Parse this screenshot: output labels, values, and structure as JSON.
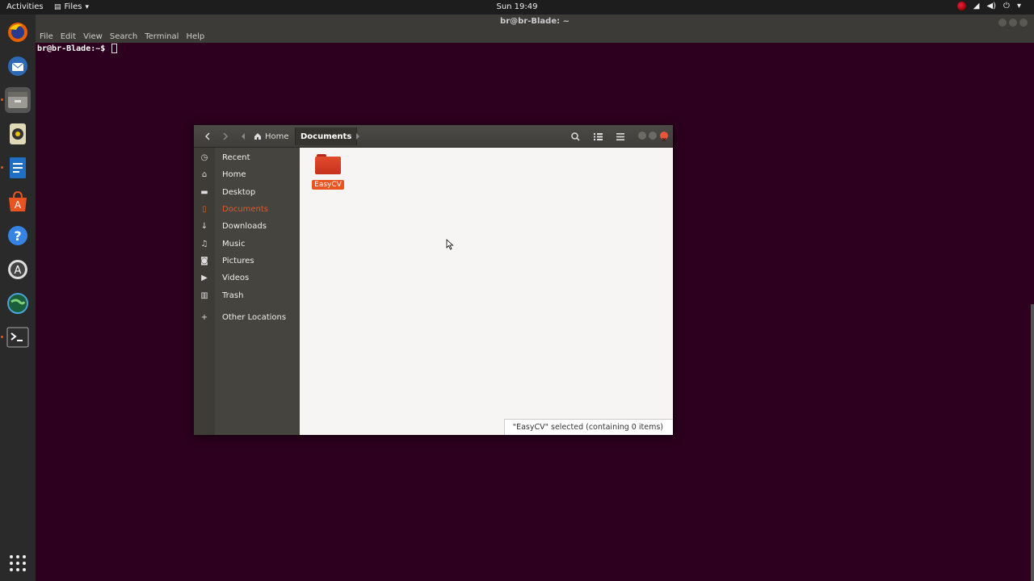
{
  "topbar": {
    "activities": "Activities",
    "app_icon": "files-icon",
    "app_name": "Files",
    "app_chevron": "▾",
    "clock": "Sun 19:49",
    "tray_icons": [
      "record-icon",
      "wifi-icon",
      "volume-icon",
      "power-icon"
    ],
    "tray_chevron": "▾"
  },
  "dock": {
    "items": [
      "firefox-icon",
      "thunderbird-icon",
      "files-icon",
      "rhythmbox-icon",
      "writer-icon",
      "software-icon",
      "help-icon",
      "updater-icon",
      "globe-icon",
      "terminal-icon"
    ],
    "show_apps_icon": "grid-icon"
  },
  "terminal": {
    "title": "br@br-Blade: ~",
    "menu": [
      "File",
      "Edit",
      "View",
      "Search",
      "Terminal",
      "Help"
    ],
    "prompt": "br@br-Blade:~$"
  },
  "files": {
    "breadcrumb": {
      "home": "Home",
      "current": "Documents"
    },
    "sidebar": [
      {
        "label": "Recent",
        "icon": "clock-icon"
      },
      {
        "label": "Home",
        "icon": "home-icon"
      },
      {
        "label": "Desktop",
        "icon": "folder-icon"
      },
      {
        "label": "Documents",
        "icon": "document-icon",
        "active": true
      },
      {
        "label": "Downloads",
        "icon": "download-icon"
      },
      {
        "label": "Music",
        "icon": "music-icon"
      },
      {
        "label": "Pictures",
        "icon": "camera-icon"
      },
      {
        "label": "Videos",
        "icon": "video-icon"
      },
      {
        "label": "Trash",
        "icon": "trash-icon"
      },
      {
        "label": "Other Locations",
        "icon": "plus-icon"
      }
    ],
    "items": [
      {
        "name": "EasyCV",
        "type": "folder",
        "selected": true
      }
    ],
    "status": "\"EasyCV\" selected  (containing 0 items)"
  },
  "colors": {
    "accent": "#e95420",
    "desktop": "#2c001e",
    "header": "#3f3e3a"
  }
}
